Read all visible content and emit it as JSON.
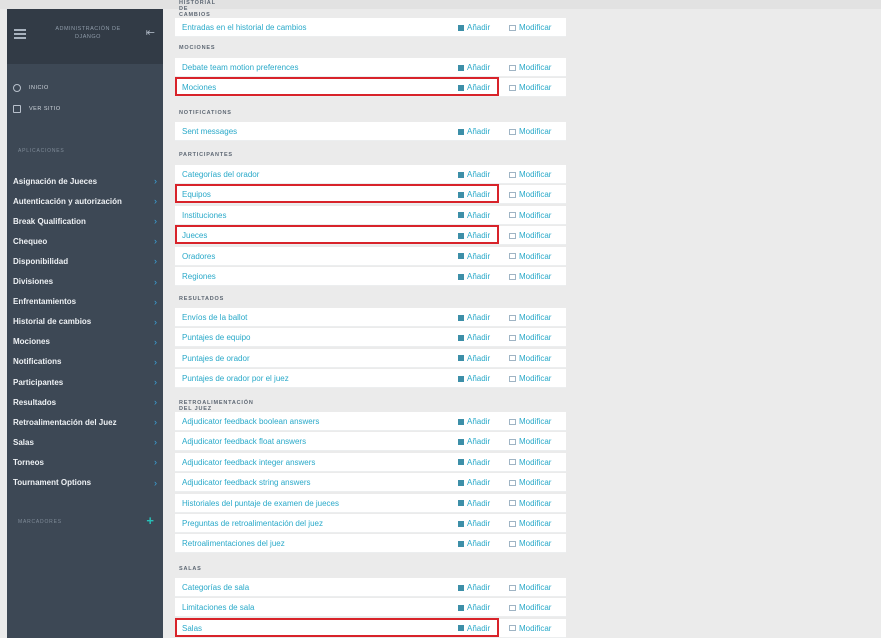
{
  "sidebar": {
    "title": "Administración de Django",
    "home_label": "Inicio",
    "site_label": "Ver sitio",
    "apps_title": "Aplicaciones",
    "bookmarks_title": "Marcadores",
    "items": [
      {
        "label": "Asignación de Jueces"
      },
      {
        "label": "Autenticación y autorización"
      },
      {
        "label": "Break Qualification"
      },
      {
        "label": "Chequeo"
      },
      {
        "label": "Disponibilidad"
      },
      {
        "label": "Divisiones"
      },
      {
        "label": "Enfrentamientos"
      },
      {
        "label": "Historial de cambios"
      },
      {
        "label": "Mociones"
      },
      {
        "label": "Notifications"
      },
      {
        "label": "Participantes"
      },
      {
        "label": "Resultados"
      },
      {
        "label": "Retroalimentación del Juez"
      },
      {
        "label": "Salas"
      },
      {
        "label": "Torneos"
      },
      {
        "label": "Tournament Options"
      }
    ]
  },
  "actions": {
    "add_label": "Añadir",
    "change_label": "Modificar"
  },
  "sections": [
    {
      "title": "Historial de cambios",
      "rows": [
        {
          "label": "Entradas en el historial de cambios"
        }
      ]
    },
    {
      "title": "Mociones",
      "rows": [
        {
          "label": "Debate team motion preferences"
        },
        {
          "label": "Mociones"
        }
      ]
    },
    {
      "title": "Notifications",
      "rows": [
        {
          "label": "Sent messages"
        }
      ]
    },
    {
      "title": "Participantes",
      "rows": [
        {
          "label": "Categorías del orador"
        },
        {
          "label": "Equipos"
        },
        {
          "label": "Instituciones"
        },
        {
          "label": "Jueces"
        },
        {
          "label": "Oradores"
        },
        {
          "label": "Regiones"
        }
      ]
    },
    {
      "title": "Resultados",
      "rows": [
        {
          "label": "Envíos de la ballot"
        },
        {
          "label": "Puntajes de equipo"
        },
        {
          "label": "Puntajes de orador"
        },
        {
          "label": "Puntajes de orador por el juez"
        }
      ]
    },
    {
      "title": "Retroalimentación del juez",
      "rows": [
        {
          "label": "Adjudicator feedback boolean answers"
        },
        {
          "label": "Adjudicator feedback float answers"
        },
        {
          "label": "Adjudicator feedback integer answers"
        },
        {
          "label": "Adjudicator feedback string answers"
        },
        {
          "label": "Historiales del puntaje de examen de jueces"
        },
        {
          "label": "Preguntas de retroalimentación del juez"
        },
        {
          "label": "Retroalimentaciones del juez"
        }
      ]
    },
    {
      "title": "Salas",
      "rows": [
        {
          "label": "Categorías de sala"
        },
        {
          "label": "Limitaciones de sala"
        },
        {
          "label": "Salas"
        }
      ]
    }
  ]
}
